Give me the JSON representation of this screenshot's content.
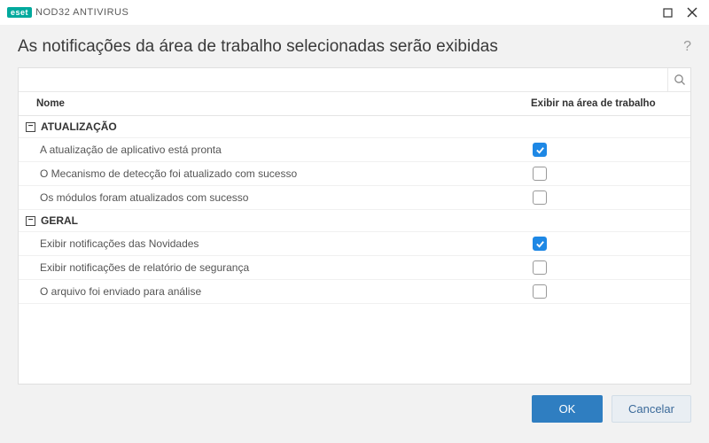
{
  "titlebar": {
    "brand_logo": "eset",
    "brand_text": "NOD32 ANTIVIRUS"
  },
  "header": {
    "title": "As notificações da área de trabalho selecionadas serão exibidas"
  },
  "search": {
    "value": "",
    "placeholder": ""
  },
  "columns": {
    "name": "Nome",
    "show": "Exibir na área de trabalho"
  },
  "groups": [
    {
      "label": "ATUALIZAÇÃO",
      "items": [
        {
          "label": "A atualização de aplicativo está pronta",
          "checked": true
        },
        {
          "label": "O Mecanismo de detecção foi atualizado com sucesso",
          "checked": false
        },
        {
          "label": "Os módulos foram atualizados com sucesso",
          "checked": false
        }
      ]
    },
    {
      "label": "GERAL",
      "items": [
        {
          "label": "Exibir notificações das Novidades",
          "checked": true
        },
        {
          "label": "Exibir notificações de relatório de segurança",
          "checked": false
        },
        {
          "label": "O arquivo foi enviado para análise",
          "checked": false
        }
      ]
    }
  ],
  "footer": {
    "ok": "OK",
    "cancel": "Cancelar"
  }
}
